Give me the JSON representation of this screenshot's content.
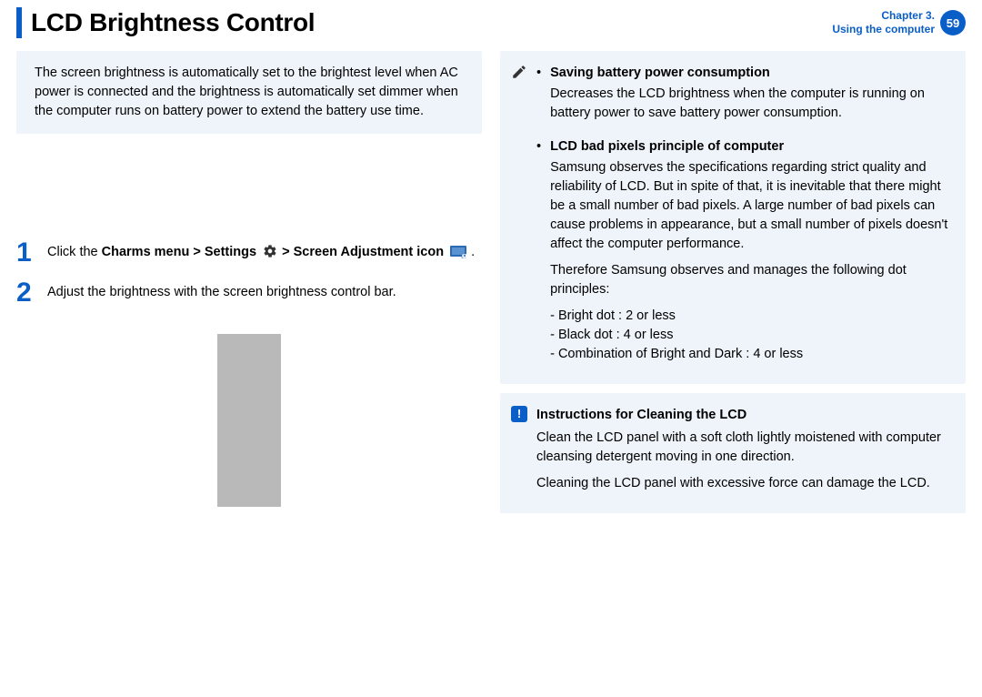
{
  "header": {
    "title": "LCD Brightness Control",
    "chapter_line1": "Chapter 3.",
    "chapter_line2": "Using the computer",
    "page_number": "59"
  },
  "left": {
    "intro_box": "The screen brightness is automatically set to the brightest level when AC power is connected and the brightness is automatically set dimmer when the computer runs on battery power to extend the battery use time.",
    "steps": [
      {
        "num": "1",
        "parts": {
          "a": "Click the ",
          "b": "Charms menu > Settings",
          "c": " > ",
          "d": "Screen Adjustment icon",
          "e": " ."
        }
      },
      {
        "num": "2",
        "text": "Adjust the brightness with the screen brightness control bar."
      }
    ]
  },
  "right": {
    "info1": {
      "bullets": [
        {
          "title": "Saving battery power consumption",
          "body": "Decreases the LCD brightness when the computer is running on battery power to save battery power consumption."
        },
        {
          "title": "LCD bad pixels principle of computer",
          "body1": "Samsung observes the specifications regarding strict quality and reliability of LCD. But in spite of that, it is inevitable that there might be a small number of bad pixels. A large number of bad pixels can cause problems in appearance, but a small number of pixels doesn't affect the computer performance.",
          "body2": "Therefore Samsung observes and manages the following dot principles:",
          "dashes": [
            "Bright dot : 2 or less",
            "Black dot  : 4 or less",
            "Combination of Bright and Dark : 4 or less"
          ]
        }
      ]
    },
    "info2": {
      "callout": "!",
      "heading": "Instructions for Cleaning the LCD",
      "p1": "Clean the LCD panel with a soft cloth lightly moistened with computer cleansing detergent moving in one direction.",
      "p2": "Cleaning the LCD panel with excessive force can damage the LCD."
    }
  }
}
